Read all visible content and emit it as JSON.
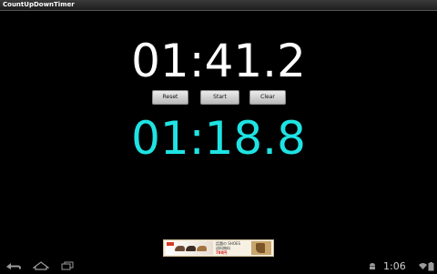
{
  "app": {
    "title": "CountUpDownTimer"
  },
  "timer_up": {
    "value": "01:41.2"
  },
  "controls": {
    "reset_label": "Reset",
    "start_label": "Start",
    "clear_label": "Clear"
  },
  "timer_down": {
    "value": "01:18.8"
  },
  "ad": {
    "price": "780円",
    "headline": "話題の SHOES",
    "subline": "送料無料"
  },
  "navbar": {
    "back_icon": "back-arrow-icon",
    "home_icon": "home-icon",
    "recent_icon": "recent-apps-icon"
  },
  "status": {
    "clock": "1:06",
    "icons": [
      "android-icon",
      "wifi-icon",
      "battery-icon"
    ]
  },
  "colors": {
    "background": "#000000",
    "timer_up": "#ffffff",
    "timer_down": "#1fe3e3"
  }
}
